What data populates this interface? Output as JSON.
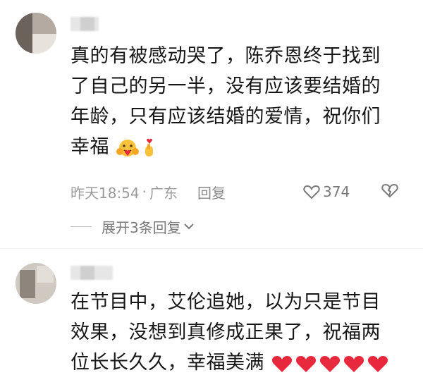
{
  "comments": [
    {
      "text_lines": [
        "真的有被感动哭了，陈乔恩终于找到",
        "了自己的另一半，没有应该要结婚的",
        "年龄，只有应该结婚的爱情，祝你们",
        "幸福"
      ],
      "emoji_names": [
        "hug-emoji-icon",
        "finger-heart-icon"
      ],
      "time": "昨天18:54",
      "location": "广东",
      "reply_label": "回复",
      "like_count": "374",
      "expand_label": "展开3条回复"
    },
    {
      "text_lines": [
        "在节目中，艾伦追她，以为只是节目",
        "效果，没想到真修成正果了，祝福两",
        "位长长久久，幸福美满"
      ],
      "emoji_names": [
        "heart-icon",
        "heart-icon",
        "heart-icon",
        "heart-icon",
        "heart-icon"
      ]
    }
  ],
  "colors": {
    "heart": "#e8283c",
    "meta": "#9a9a9a"
  }
}
